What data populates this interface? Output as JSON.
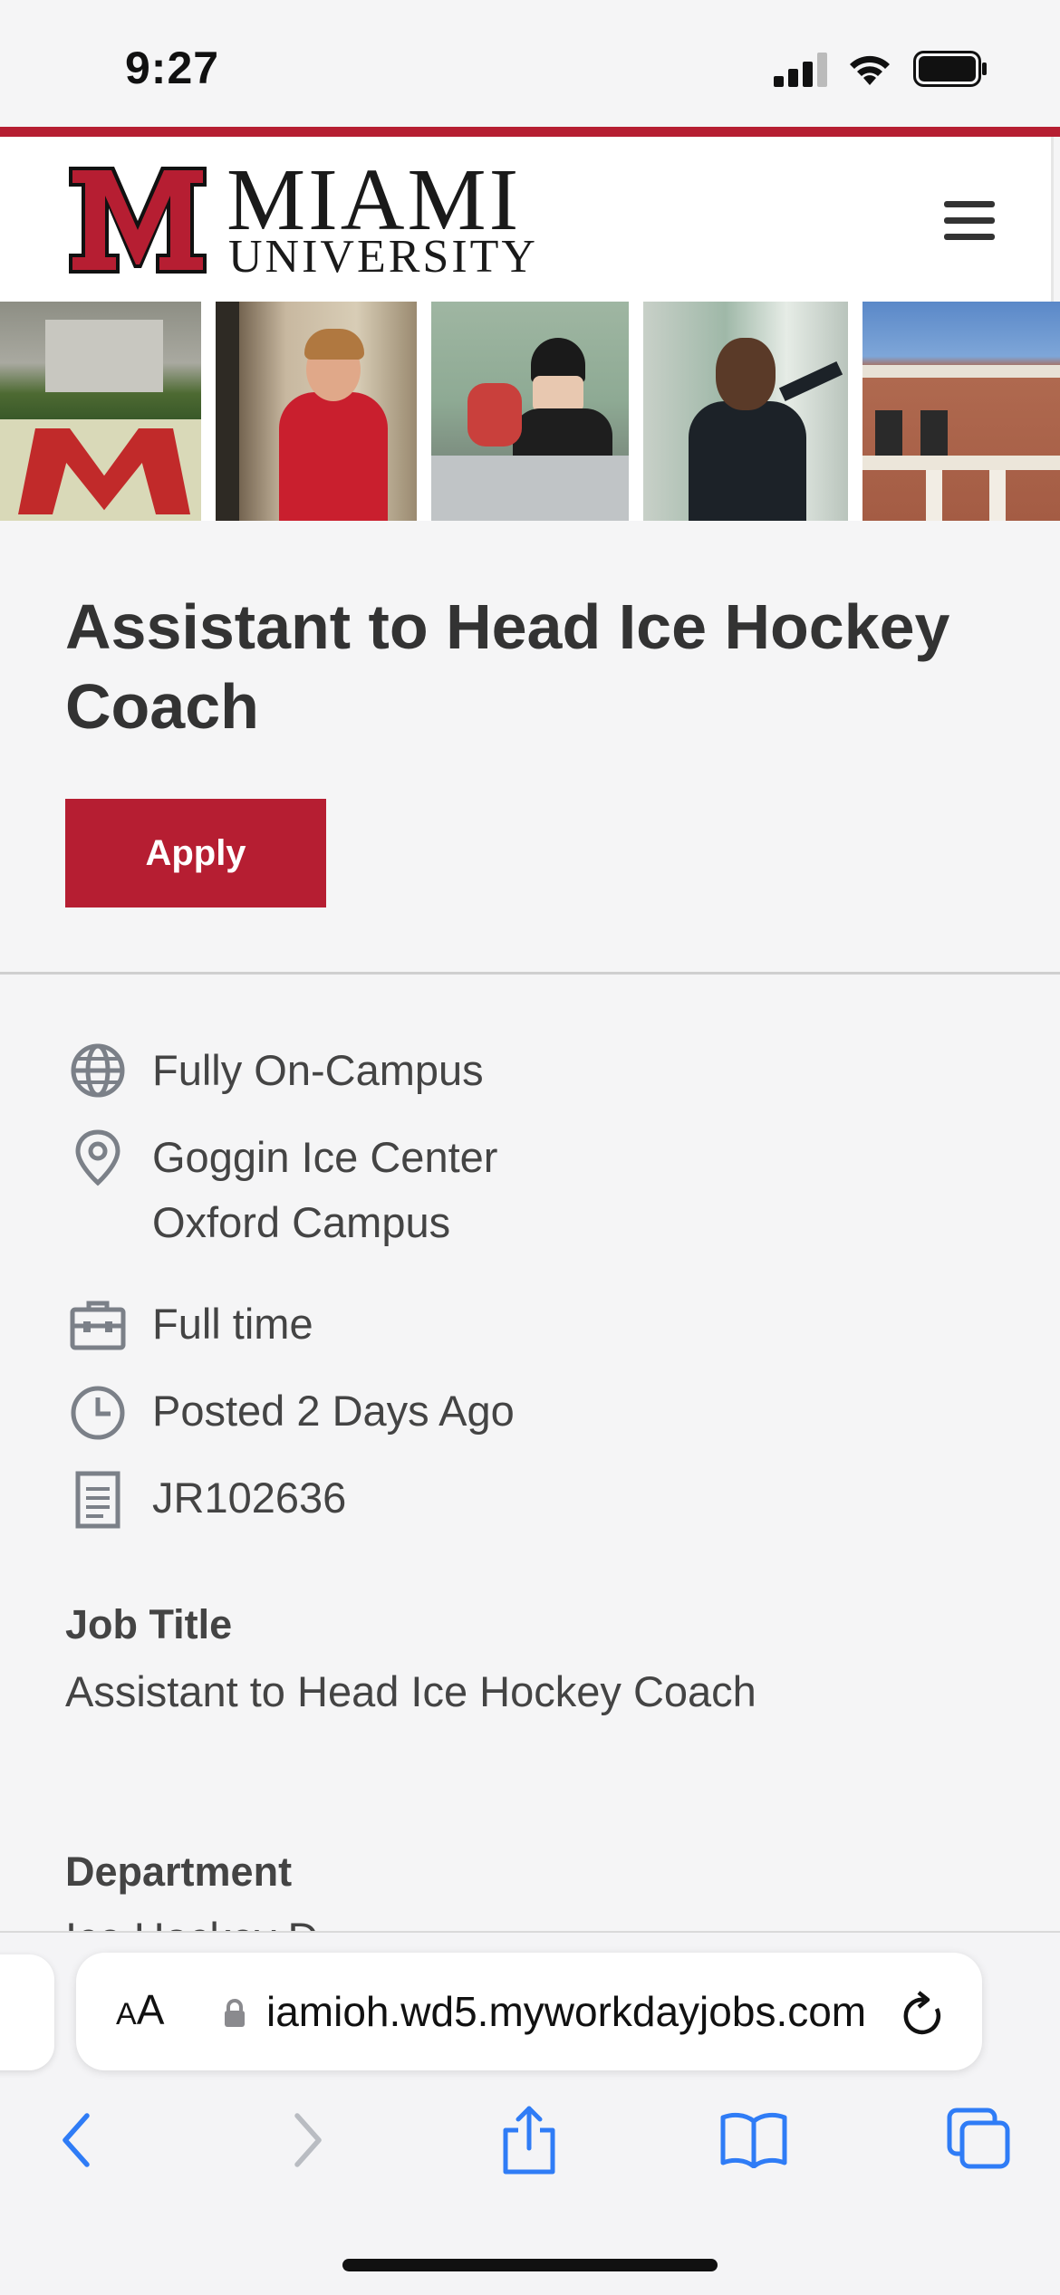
{
  "status_bar": {
    "time": "9:27"
  },
  "header": {
    "logo_line_1": "MIAMI",
    "logo_line_2": "UNIVERSITY",
    "brand_color": "#b61e32"
  },
  "job": {
    "title_heading": "Assistant to Head Ice Hockey Coach",
    "apply_label": "Apply",
    "details": [
      {
        "icon": "globe-icon",
        "text": "Fully On-Campus"
      },
      {
        "icon": "location-pin-icon",
        "line1": "Goggin Ice Center",
        "line2": "Oxford Campus"
      },
      {
        "icon": "briefcase-icon",
        "text": "Full time"
      },
      {
        "icon": "clock-icon",
        "text": "Posted 2 Days Ago"
      },
      {
        "icon": "document-icon",
        "text": "JR102636"
      }
    ],
    "sections": [
      {
        "label": "Job Title",
        "value": "Assistant to Head Ice Hockey Coach"
      },
      {
        "label": "Department",
        "value": "Ice Hockey D..."
      }
    ]
  },
  "browser": {
    "text_size_label_small": "A",
    "text_size_label_large": "A",
    "url": "iamioh.wd5.myworkdayjobs.com",
    "accent_color": "#2f7cf6"
  }
}
